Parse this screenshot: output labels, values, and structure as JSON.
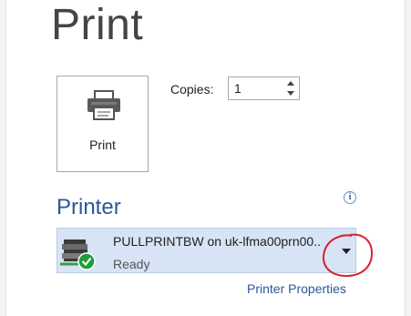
{
  "page": {
    "title": "Print"
  },
  "print_button": {
    "label": "Print",
    "icon": "printer-icon"
  },
  "copies": {
    "label": "Copies:",
    "value": "1"
  },
  "printer_section": {
    "title": "Printer",
    "info_icon": "info-icon",
    "selected_printer": {
      "name": "PULLPRINTBW on uk-lfma00prn00..",
      "status": "Ready",
      "icon": "network-printer-ready-icon"
    },
    "properties_link": "Printer Properties"
  },
  "colors": {
    "accent": "#2b579a",
    "selection_bg": "#d6e4f5",
    "annotation": "#d9202a",
    "status_ok": "#1e9d3d"
  }
}
